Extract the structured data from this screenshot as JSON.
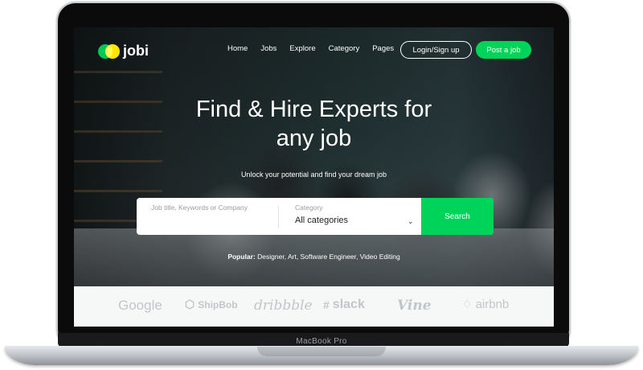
{
  "device": {
    "model_label": "MacBook Pro"
  },
  "brand": {
    "name": "jobi",
    "accent": "#00d35a",
    "logo_colors": [
      "#00c853",
      "#ffe600"
    ]
  },
  "nav": {
    "links": [
      "Home",
      "Jobs",
      "Explore",
      "Category",
      "Pages"
    ],
    "login_label": "Login/Sign up",
    "post_job_label": "Post a job"
  },
  "hero": {
    "title_line1": "Find & Hire Experts for",
    "title_line2": "any job",
    "subtitle": "Unlock your potential and find your dream job"
  },
  "search": {
    "keyword_placeholder": "Job title, Keywords or Company",
    "category_label": "Category",
    "category_value": "All categories",
    "button_label": "Search"
  },
  "popular": {
    "label": "Popular:",
    "items": "Designer, Art, Software Engineer, Video Editing"
  },
  "partners": {
    "google": "Google",
    "shipbob": "ShipBob",
    "dribbble": "dribbble",
    "slack": "slack",
    "vine": "Vine",
    "airbnb": "airbnb"
  }
}
